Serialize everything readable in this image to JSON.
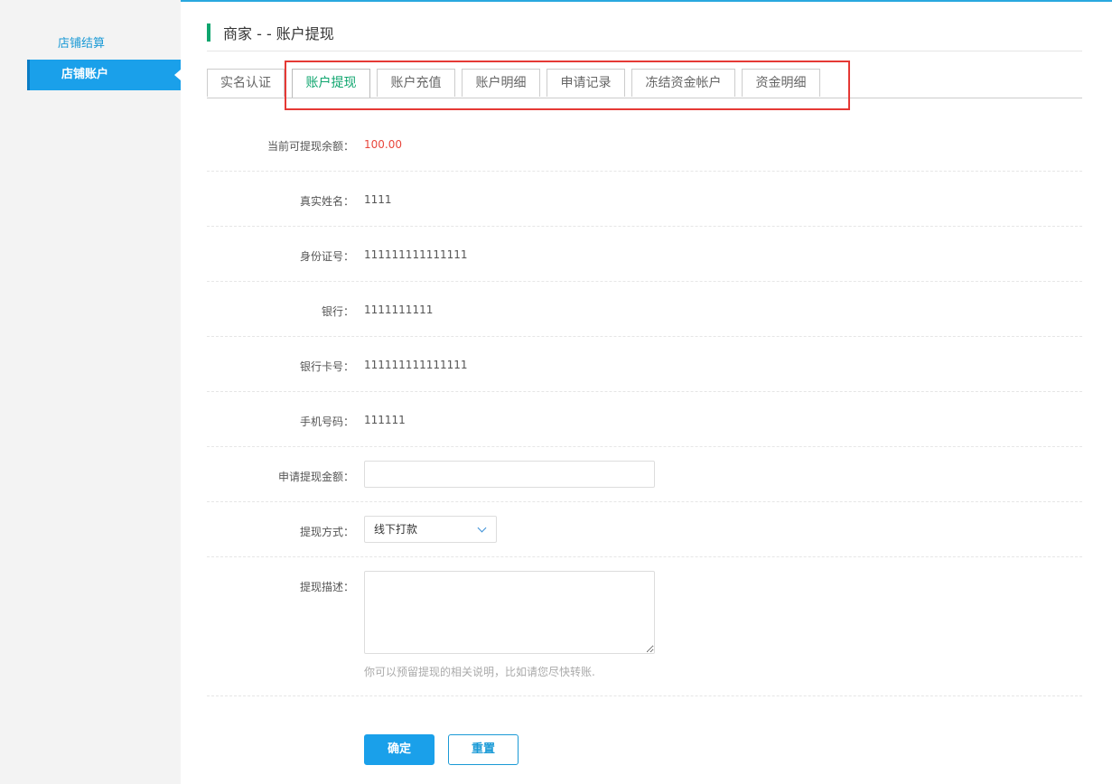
{
  "sidebar": {
    "items": [
      {
        "label": "店铺结算",
        "active": false
      },
      {
        "label": "店铺账户",
        "active": true
      }
    ]
  },
  "header": {
    "title": "商家 - - 账户提现"
  },
  "tabs": [
    {
      "label": "实名认证",
      "active": false
    },
    {
      "label": "账户提现",
      "active": true
    },
    {
      "label": "账户充值",
      "active": false
    },
    {
      "label": "账户明细",
      "active": false
    },
    {
      "label": "申请记录",
      "active": false
    },
    {
      "label": "冻结资金帐户",
      "active": false
    },
    {
      "label": "资金明细",
      "active": false
    }
  ],
  "form": {
    "balance": {
      "label": "当前可提现余额：",
      "value": "100.00"
    },
    "real_name": {
      "label": "真实姓名：",
      "value": "1111"
    },
    "id_number": {
      "label": "身份证号：",
      "value": "111111111111111"
    },
    "bank": {
      "label": "银行：",
      "value": "1111111111"
    },
    "bank_card": {
      "label": "银行卡号：",
      "value": "111111111111111"
    },
    "phone": {
      "label": "手机号码：",
      "value": "111111"
    },
    "amount": {
      "label": "申请提现金额：",
      "value": ""
    },
    "method": {
      "label": "提现方式：",
      "selected": "线下打款"
    },
    "description": {
      "label": "提现描述：",
      "value": "",
      "hint": "你可以预留提现的相关说明，比如请您尽快转账."
    }
  },
  "buttons": {
    "confirm": "确定",
    "reset": "重置"
  },
  "colors": {
    "accent": "#1aa0ea",
    "header_bar": "#0fa56e",
    "active_tab_text": "#0fa56e",
    "balance": "#e8463c",
    "highlight_box": "#e53935"
  }
}
